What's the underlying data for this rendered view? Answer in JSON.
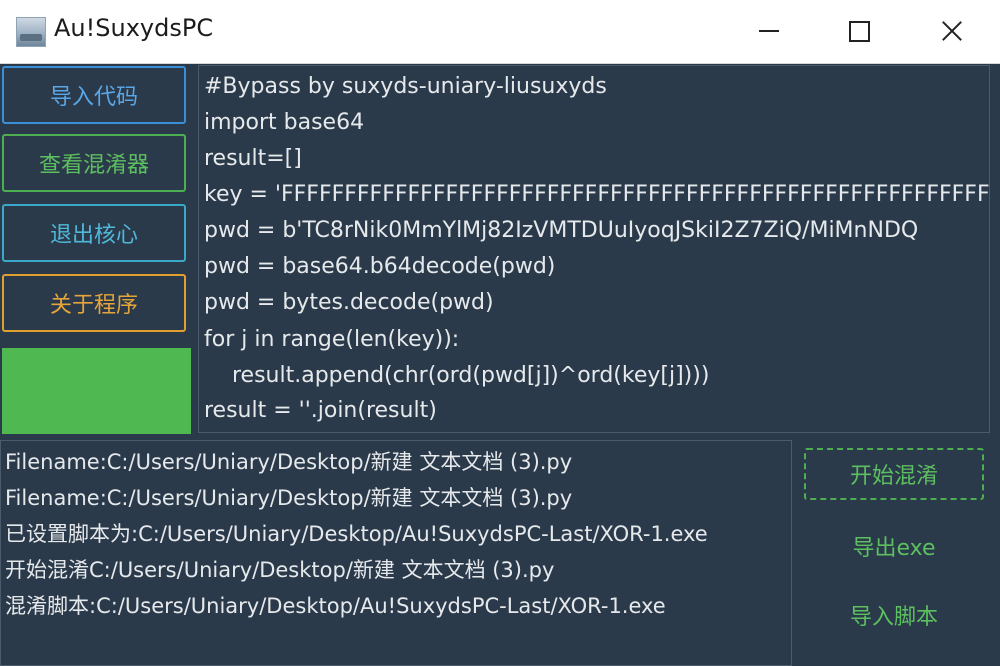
{
  "window": {
    "title": "Au!SuxydsPC",
    "icon": "app-icon",
    "controls": [
      "minimize-icon",
      "maximize-icon",
      "close-icon"
    ]
  },
  "sidebar": {
    "buttons": [
      {
        "label": "导入代码",
        "color": "#3a8fd6"
      },
      {
        "label": "查看混淆器",
        "color": "#4caf50"
      },
      {
        "label": "退出核心",
        "color": "#3aa8c8"
      },
      {
        "label": "关于程序",
        "color": "#e0a030"
      }
    ],
    "status_color": "#4fb851"
  },
  "code_editor": {
    "lines": [
      "#Bypass by suxyds-uniary-liusuxyds",
      "import base64",
      "result=[]",
      "key = 'FFFFFFFFFFFFFFFFFFFFFFFFFFFFFFFFFFFFFFFFFFFFFFFFFFFFFFFFFFFFFFFF",
      "pwd = b'TC8rNik0MmYlMj82IzVMTDUuIyoqJSkiI2Z7ZiQ/MiMnNDQ",
      "pwd = base64.b64decode(pwd)",
      "pwd = bytes.decode(pwd)",
      "for j in range(len(key)):",
      "    result.append(chr(ord(pwd[j])^ord(key[j])))",
      "result = ''.join(result)"
    ]
  },
  "log": {
    "lines": [
      "Filename:C:/Users/Uniary/Desktop/新建 文本文档 (3).py",
      "Filename:C:/Users/Uniary/Desktop/新建 文本文档 (3).py",
      "已设置脚本为:C:/Users/Uniary/Desktop/Au!SuxydsPC-Last/XOR-1.exe",
      "开始混淆C:/Users/Uniary/Desktop/新建 文本文档 (3).py",
      "混淆脚本:C:/Users/Uniary/Desktop/Au!SuxydsPC-Last/XOR-1.exe"
    ]
  },
  "actions": {
    "start_label": "开始混淆",
    "export_label": "导出exe",
    "import_script_label": "导入脚本",
    "accent_color": "#4caf50"
  }
}
